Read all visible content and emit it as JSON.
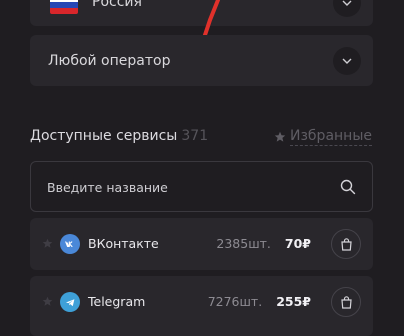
{
  "country": {
    "label": "Россия"
  },
  "operator": {
    "label": "Любой оператор"
  },
  "services": {
    "title": "Доступные сервисы",
    "count": "371"
  },
  "favorites": {
    "label": "Избранные"
  },
  "search": {
    "placeholder": "Введите название"
  },
  "rows": [
    {
      "name": "ВКонтакте",
      "quantity": "2385шт.",
      "price": "70₽",
      "icon": "vk-icon",
      "color": "#4a88d8"
    },
    {
      "name": "Telegram",
      "quantity": "7276шт.",
      "price": "255₽",
      "icon": "telegram-icon",
      "color": "#3ea0d8"
    }
  ],
  "colors": {
    "background": "#1f1d21",
    "card": "#29272c",
    "annotation_arrow": "#e0312b"
  }
}
